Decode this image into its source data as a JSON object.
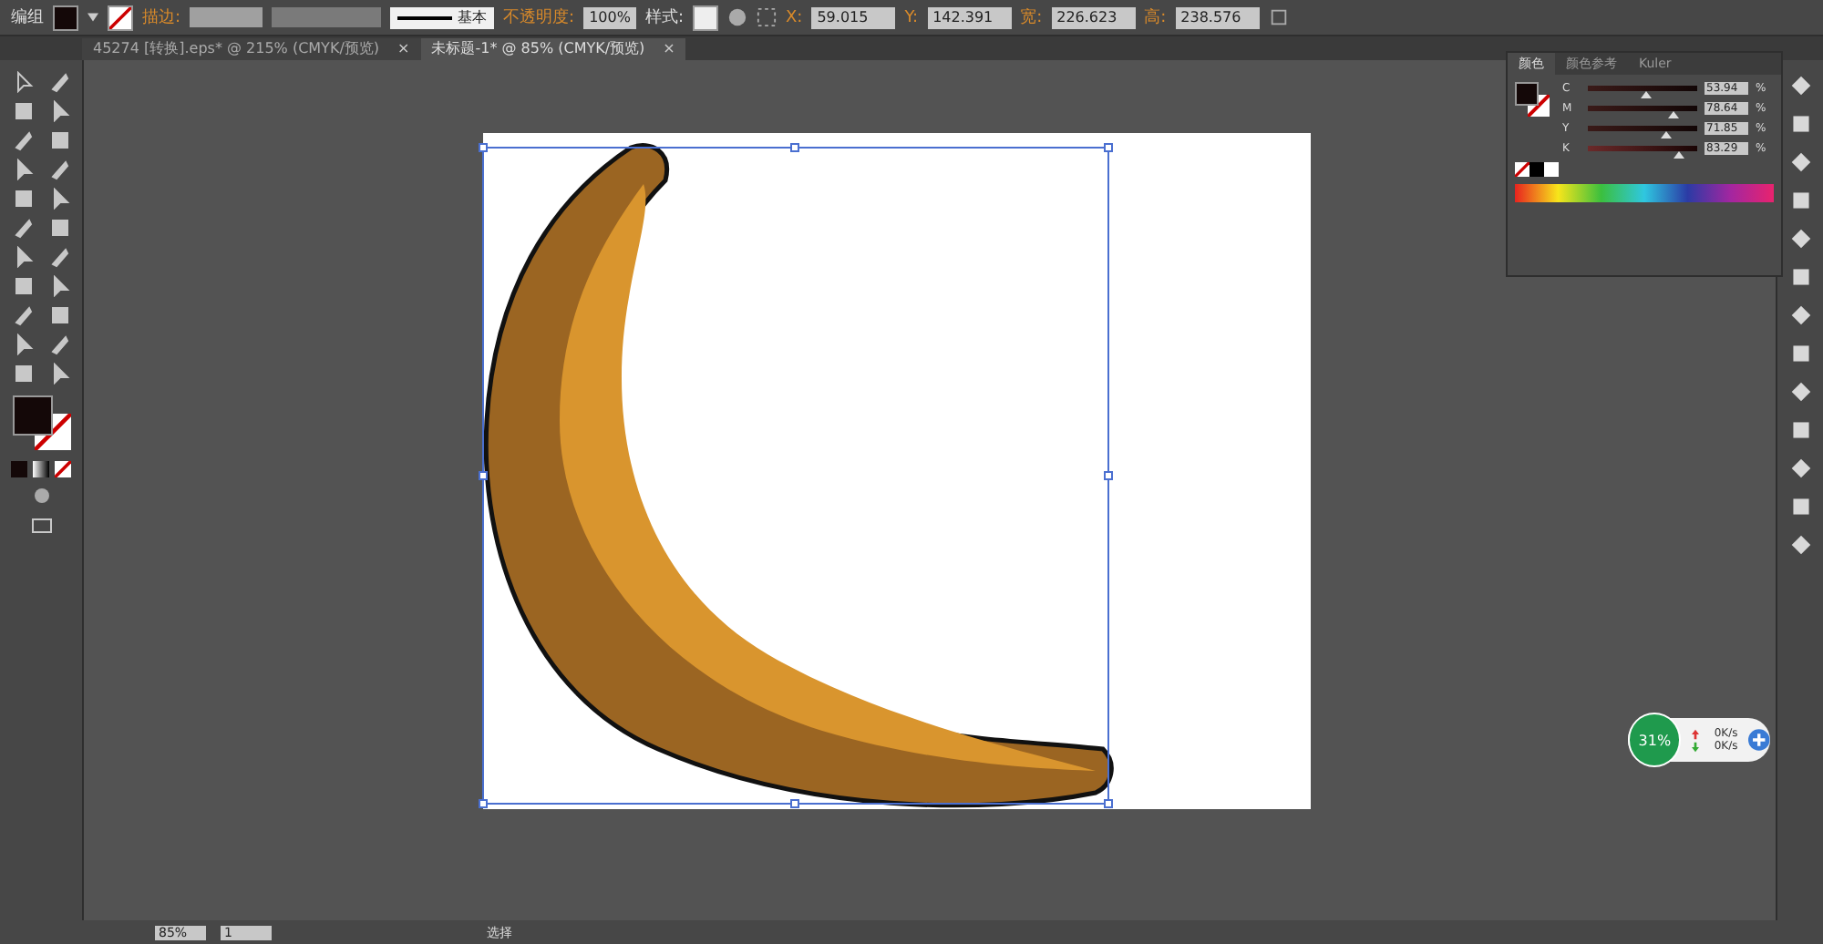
{
  "control_bar": {
    "selection_label": "编组",
    "stroke_label": "描边:",
    "stroke_profile": "基本",
    "opacity_label": "不透明度:",
    "opacity": "100%",
    "style_label": "样式:",
    "transform": [
      {
        "label": "X:",
        "value": "59.015"
      },
      {
        "label": "Y:",
        "value": "142.391"
      },
      {
        "label": "宽:",
        "value": "226.623"
      },
      {
        "label": "高:",
        "value": "238.576"
      }
    ]
  },
  "tabs": [
    {
      "label": "45274 [转换].eps* @ 215% (CMYK/预览)",
      "selected": false,
      "close": "×"
    },
    {
      "label": "未标题-1* @ 85% (CMYK/预览)",
      "selected": true,
      "close": "×"
    }
  ],
  "color_panel": {
    "tabs": [
      {
        "label": "颜色",
        "selected": true
      },
      {
        "label": "颜色参考",
        "selected": false
      },
      {
        "label": "Kuler",
        "selected": false
      }
    ],
    "channels": [
      {
        "name": "C",
        "level": 0.54,
        "reading": "53.94",
        "unit": "%"
      },
      {
        "name": "M",
        "level": 0.79,
        "reading": "78.64",
        "unit": "%"
      },
      {
        "name": "Y",
        "level": 0.72,
        "reading": "71.85",
        "unit": "%"
      },
      {
        "name": "K",
        "level": 0.83,
        "reading": "83.29",
        "unit": "%"
      }
    ]
  },
  "net_widget": {
    "percent": "31%",
    "upload": "0K/s",
    "download": "0K/s"
  },
  "status_bar": {
    "zoom": "85%",
    "page": "1",
    "tool": "选择"
  }
}
